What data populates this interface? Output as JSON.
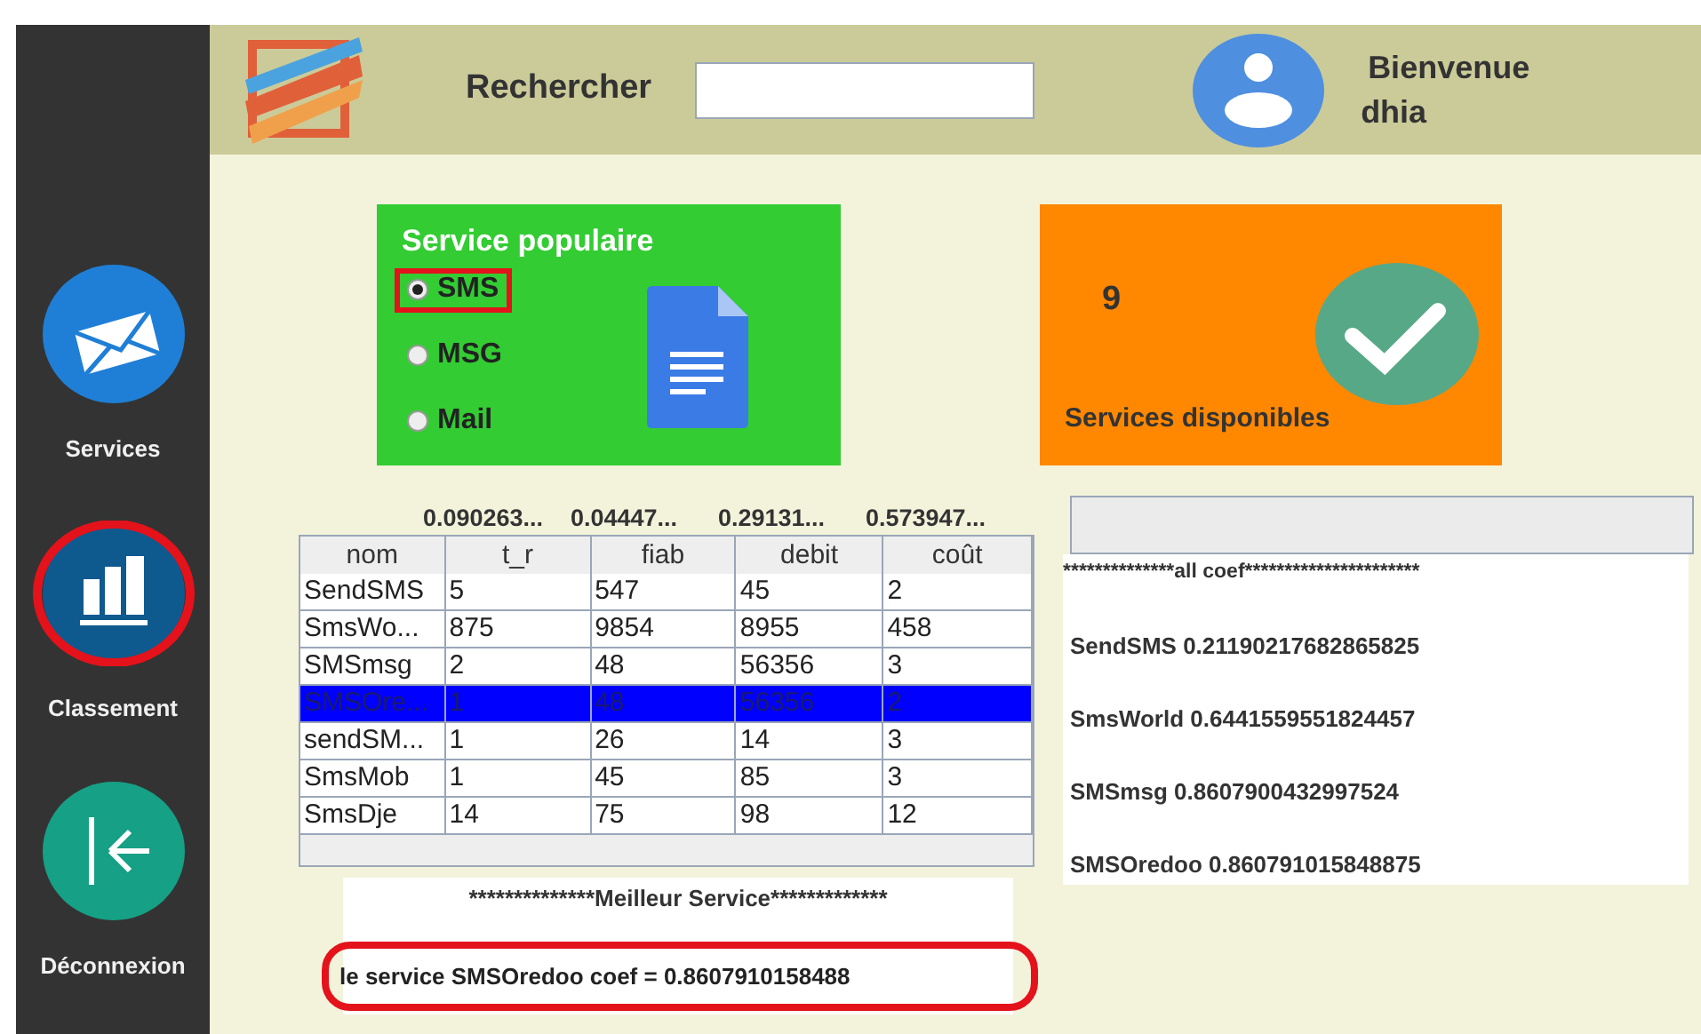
{
  "sidebar": {
    "items": [
      {
        "label": "Services",
        "highlighted": false
      },
      {
        "label": "Classement",
        "highlighted": true
      },
      {
        "label": "Déconnexion",
        "highlighted": false
      }
    ]
  },
  "header": {
    "search_label": "Rechercher",
    "welcome": "Bienvenue",
    "user": "dhia"
  },
  "popular_card": {
    "title": "Service populaire",
    "options": [
      {
        "label": "SMS",
        "selected": true,
        "highlighted": true
      },
      {
        "label": "MSG",
        "selected": false,
        "highlighted": false
      },
      {
        "label": "Mail",
        "selected": false,
        "highlighted": false
      }
    ]
  },
  "available_card": {
    "count": "9",
    "label": "Services disponibles"
  },
  "table": {
    "weights": [
      "0.090263...",
      "0.04447...",
      "0.29131...",
      "0.573947..."
    ],
    "columns": [
      "nom",
      "t_r",
      "fiab",
      "debit",
      "coût"
    ],
    "rows": [
      {
        "cells": [
          "SendSMS",
          "5",
          "547",
          "45",
          "2"
        ],
        "selected": false
      },
      {
        "cells": [
          "SmsWo...",
          "875",
          "9854",
          "8955",
          "458"
        ],
        "selected": false
      },
      {
        "cells": [
          "SMSmsg",
          "2",
          "48",
          "56356",
          "3"
        ],
        "selected": false
      },
      {
        "cells": [
          "SMSOre...",
          "1",
          "48",
          "56356",
          "2"
        ],
        "selected": true
      },
      {
        "cells": [
          "sendSM...",
          "1",
          "26",
          "14",
          "3"
        ],
        "selected": false
      },
      {
        "cells": [
          "SmsMob",
          "1",
          "45",
          "85",
          "3"
        ],
        "selected": false
      },
      {
        "cells": [
          "SmsDje",
          "14",
          "75",
          "98",
          "12"
        ],
        "selected": false
      }
    ]
  },
  "coef_panel": {
    "title": "**************all coef**********************",
    "lines": [
      "SendSMS 0.21190217682865825",
      "SmsWorld 0.6441559551824457",
      "SMSmsg 0.8607900432997524",
      "SMSOredoo 0.860791015848875"
    ]
  },
  "best_service": {
    "title": "**************Meilleur Service*************",
    "result": "le service SMSOredoo  coef = 0.8607910158488",
    "highlighted": true
  }
}
